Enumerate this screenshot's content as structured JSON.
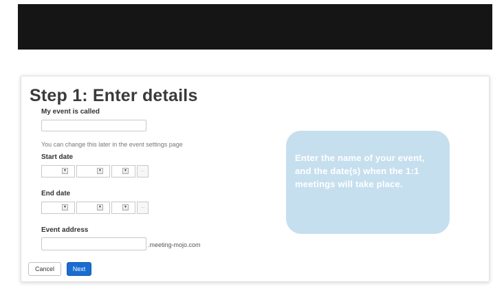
{
  "form": {
    "title": "Step 1: Enter details",
    "event_name": {
      "label": "My event is called",
      "value": "",
      "hint": "You can change this later in the event settings page"
    },
    "start_date": {
      "label": "Start date",
      "picker_label": "..."
    },
    "end_date": {
      "label": "End date",
      "picker_label": "..."
    },
    "event_address": {
      "label": "Event address",
      "value": "",
      "suffix": ".meeting-mojo.com"
    },
    "buttons": {
      "cancel": "Cancel",
      "next": "Next"
    }
  },
  "tooltip": {
    "text": "Enter the name of your event, and the date(s) when the 1:1 meetings will take place."
  },
  "colors": {
    "top_bar": "#151515",
    "primary_button": "#1a6dd0",
    "tooltip_background": "#c6dfee"
  },
  "icons": {
    "select_arrow": "triangle-down-icon"
  }
}
